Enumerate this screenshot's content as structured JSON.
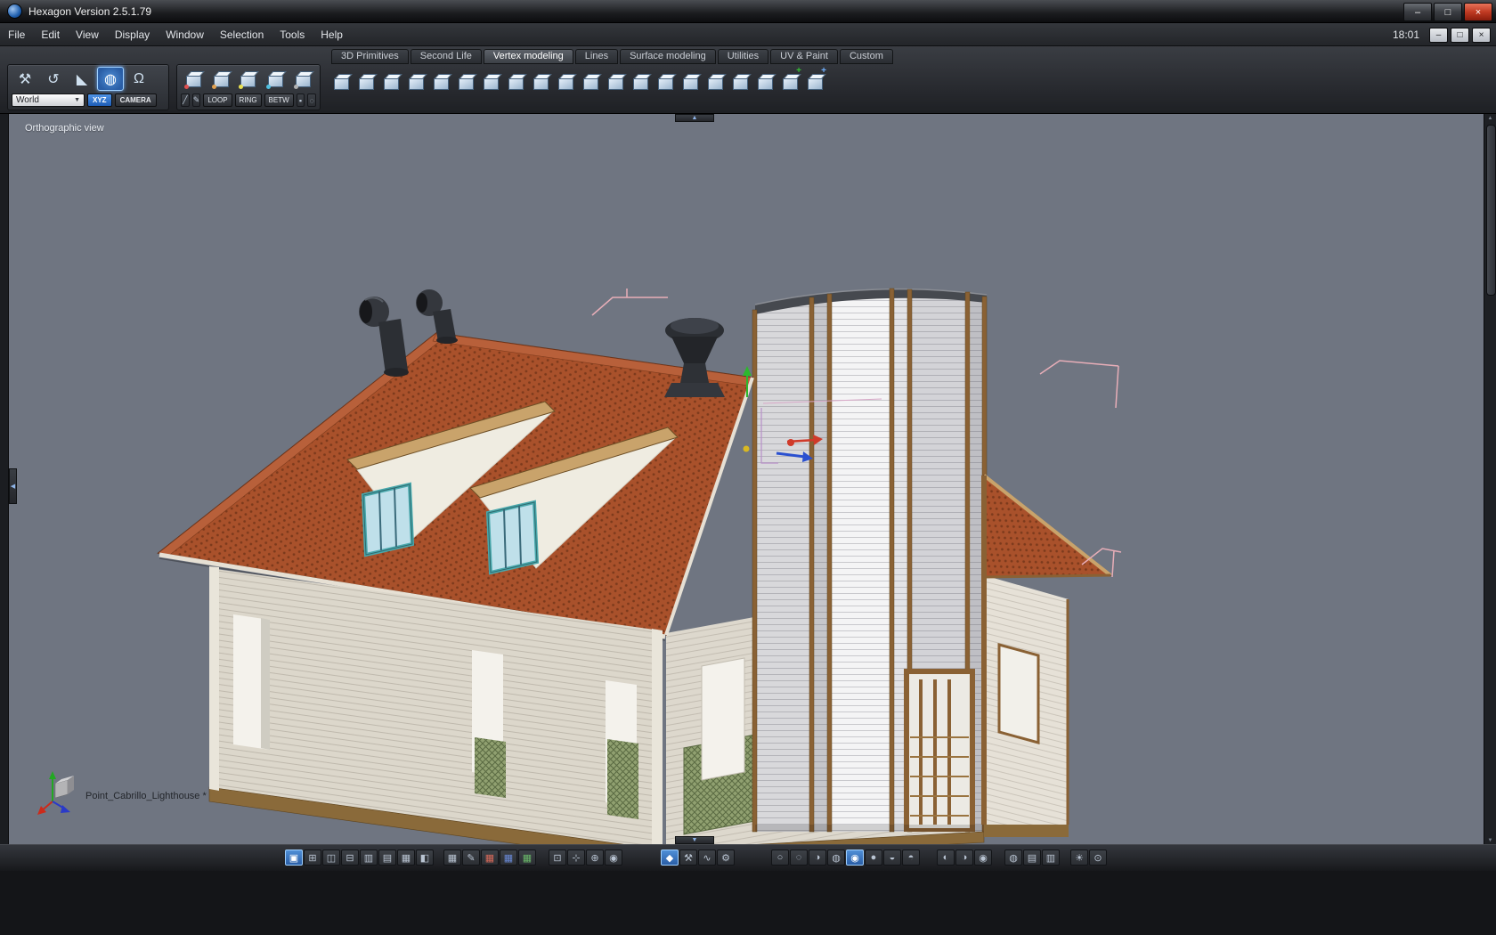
{
  "titlebar": {
    "title": "Hexagon Version 2.5.1.79",
    "minimize_glyph": "–",
    "maximize_glyph": "□",
    "close_glyph": "×"
  },
  "menubar": {
    "items": [
      "File",
      "Edit",
      "View",
      "Display",
      "Window",
      "Selection",
      "Tools",
      "Help"
    ],
    "clock": "18:01",
    "minimize_glyph": "–",
    "maximize_glyph": "□",
    "close_glyph": "×"
  },
  "tabs": [
    {
      "label": "3D Primitives",
      "active": false
    },
    {
      "label": "Second Life",
      "active": false
    },
    {
      "label": "Vertex modeling",
      "active": true
    },
    {
      "label": "Lines",
      "active": false
    },
    {
      "label": "Surface modeling",
      "active": false
    },
    {
      "label": "Utilities",
      "active": false
    },
    {
      "label": "UV & Paint",
      "active": false
    },
    {
      "label": "Custom",
      "active": false
    }
  ],
  "select_panel": {
    "tools": [
      {
        "name": "hammer-tool-icon",
        "glyph": "⚒",
        "active": false
      },
      {
        "name": "rotate-tool-icon",
        "glyph": "↺",
        "active": false
      },
      {
        "name": "cone-tool-icon",
        "glyph": "◣",
        "active": false
      },
      {
        "name": "sphere-tool-icon",
        "glyph": "◍",
        "active": true
      },
      {
        "name": "ghost-tool-icon",
        "glyph": "Ω",
        "active": false
      }
    ],
    "world_dropdown": {
      "value": "World",
      "arrow": "▼"
    },
    "xyz_label": "XYZ",
    "camera_label": "CAMERA"
  },
  "modes_panel": {
    "cubes": [
      "select-points",
      "select-edges",
      "select-faces",
      "select-object",
      "select-uv"
    ],
    "cube_accents": [
      "#e05050",
      "#e0a050",
      "#e8e050",
      "#50c0e0",
      "#b0b0b0"
    ],
    "pre_icons": [
      {
        "name": "edge-line-icon",
        "glyph": "╱"
      },
      {
        "name": "pen-select-icon",
        "glyph": "✎"
      }
    ],
    "buttons": [
      "LOOP",
      "RING",
      "BETW"
    ],
    "post_icons": [
      {
        "name": "list-select-icon",
        "glyph": "▪"
      },
      {
        "name": "ring-select-icon",
        "glyph": "◌"
      }
    ]
  },
  "vertex_tools": {
    "icons": [
      "tessellate",
      "smooth",
      "extract",
      "dissociate",
      "weld",
      "chamfer",
      "extrude-surface",
      "extrude-profile",
      "sweep",
      "thickness",
      "symmetry",
      "bend",
      "twist",
      "taper",
      "copy",
      "mirror",
      "bridge",
      "connect",
      "add-points",
      "magnet"
    ],
    "add_badge": "+",
    "magnet_badge": "+"
  },
  "viewport": {
    "view_label": "Orthographic view",
    "model_name": "Point_Cabrillo_Lighthouse *",
    "handles": {
      "top": "▲",
      "bottom": "▼",
      "left": "◀"
    },
    "scroll_up": "▲",
    "scroll_down": "▼"
  },
  "bottom_toolbar": {
    "layout_group": [
      {
        "name": "layout-single-view-icon",
        "glyph": "▣",
        "active": true
      },
      {
        "name": "layout-quad-view-icon",
        "glyph": "⊞",
        "active": false
      },
      {
        "name": "layout-two-vertical-icon",
        "glyph": "◫",
        "active": false
      },
      {
        "name": "layout-two-horizontal-icon",
        "glyph": "⊟",
        "active": false
      },
      {
        "name": "layout-three-left-icon",
        "glyph": "▥",
        "active": false
      },
      {
        "name": "layout-three-top-icon",
        "glyph": "▤",
        "active": false
      },
      {
        "name": "layout-grid-icon",
        "glyph": "▦",
        "active": false
      },
      {
        "name": "layout-split-icon",
        "glyph": "◧",
        "active": false
      }
    ],
    "grid_group": [
      {
        "name": "grid-toggle-icon",
        "glyph": "▦",
        "color": "#b9c4d2"
      },
      {
        "name": "edit-grid-icon",
        "glyph": "✎",
        "color": "#b9c4d2"
      },
      {
        "name": "grid-x-plane-icon",
        "glyph": "▦",
        "color": "#d86a5a"
      },
      {
        "name": "grid-y-plane-icon",
        "glyph": "▦",
        "color": "#6a8ad8"
      },
      {
        "name": "grid-z-plane-icon",
        "glyph": "▦",
        "color": "#6ab86a"
      }
    ],
    "zoom_group": [
      {
        "name": "select-region-icon",
        "glyph": "⊡"
      },
      {
        "name": "pan-view-icon",
        "glyph": "⊹"
      },
      {
        "name": "zoom-view-icon",
        "glyph": "⊕"
      },
      {
        "name": "fit-view-icon",
        "glyph": "◉"
      }
    ],
    "manip_group": [
      {
        "name": "manipulator-icon",
        "glyph": "◆",
        "active": true
      },
      {
        "name": "tools-icon",
        "glyph": "⚒",
        "active": false
      },
      {
        "name": "soft-selection-icon",
        "glyph": "∿",
        "active": false
      },
      {
        "name": "settings-icon",
        "glyph": "⚙",
        "active": false
      }
    ],
    "shading_group": [
      {
        "name": "wireframe-mode-icon",
        "glyph": "○",
        "active": false
      },
      {
        "name": "hidden-line-mode-icon",
        "glyph": "◌",
        "active": false
      },
      {
        "name": "flat-shade-mode-icon",
        "glyph": "◑",
        "active": false
      },
      {
        "name": "shaded-wire-mode-icon",
        "glyph": "◍",
        "active": false
      },
      {
        "name": "smooth-shade-mode-icon",
        "glyph": "◉",
        "active": true
      },
      {
        "name": "textured-mode-icon",
        "glyph": "●",
        "active": false
      },
      {
        "name": "material-mode-icon",
        "glyph": "◒",
        "active": false
      },
      {
        "name": "ghost-mode-icon",
        "glyph": "◓",
        "active": false
      }
    ],
    "display_group": [
      {
        "name": "smooth-low-icon",
        "glyph": "◐"
      },
      {
        "name": "smooth-med-icon",
        "glyph": "◑"
      },
      {
        "name": "smooth-high-icon",
        "glyph": "◉"
      }
    ],
    "misc_group": [
      {
        "name": "backface-icon",
        "glyph": "◍"
      },
      {
        "name": "layers-icon",
        "glyph": "▤"
      },
      {
        "name": "panels-icon",
        "glyph": "▥"
      }
    ],
    "render_group": [
      {
        "name": "lighting-icon",
        "glyph": "☀"
      },
      {
        "name": "camera-icon",
        "glyph": "⊙"
      }
    ]
  },
  "colors": {
    "viewport_bg": "#6f7581",
    "roof": "#a9512b",
    "roof_dark": "#7c3a1c",
    "wall": "#dcd7cb",
    "trim_wood": "#8a6134",
    "tower": "#ececee",
    "accent_blue": "#3f7fd0",
    "gizmo_green": "#2db82d",
    "gizmo_red": "#d03a2a",
    "gizmo_blue": "#2a50d0",
    "selection_pink": "#e8aeb8"
  }
}
